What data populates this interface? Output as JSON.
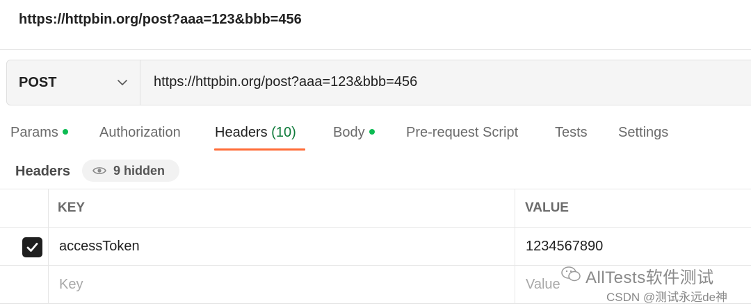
{
  "title": "https://httpbin.org/post?aaa=123&bbb=456",
  "request": {
    "method": "POST",
    "url": "https://httpbin.org/post?aaa=123&bbb=456"
  },
  "tabs": [
    {
      "label": "Params",
      "dot": true
    },
    {
      "label": "Authorization"
    },
    {
      "label": "Headers",
      "count": "(10)",
      "active": true
    },
    {
      "label": "Body",
      "dot": true
    },
    {
      "label": "Pre-request Script"
    },
    {
      "label": "Tests"
    },
    {
      "label": "Settings"
    }
  ],
  "headers_section": {
    "label": "Headers",
    "hidden_label": "9 hidden"
  },
  "table": {
    "columns": {
      "key": "KEY",
      "value": "VALUE"
    },
    "rows": [
      {
        "checked": true,
        "key": "accessToken",
        "value": "1234567890"
      }
    ],
    "new_row": {
      "key_placeholder": "Key",
      "value_placeholder": "Value"
    }
  },
  "watermark": {
    "brand": "AllTests软件测试",
    "credit": "CSDN @测试永远de神"
  },
  "colors": {
    "accent_underline": "#ff6c37",
    "dot_green": "#0cbb52",
    "count_green": "#0e7a3a"
  }
}
